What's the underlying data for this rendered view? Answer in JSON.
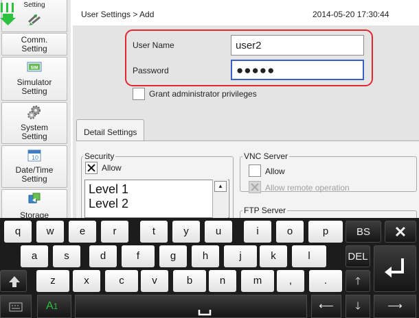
{
  "sidebar": {
    "items": [
      {
        "label": "Setting",
        "icon": "network-arrows-icon"
      },
      {
        "label": "Comm.\nSetting",
        "icon": "comm-icon"
      },
      {
        "label": "Simulator\nSetting",
        "icon": "sim-card-icon",
        "badge": "SIM"
      },
      {
        "label": "System\nSetting",
        "icon": "gears-icon"
      },
      {
        "label": "Date/Time\nSetting",
        "icon": "calendar-icon",
        "badge": "10"
      },
      {
        "label": "Storage",
        "icon": "storage-icon"
      }
    ]
  },
  "header": {
    "breadcrumb": "User Settings > Add",
    "datetime": "2014-05-20 17:30:44"
  },
  "form": {
    "user_name_label": "User Name",
    "user_name_value": "user2",
    "password_label": "Password",
    "password_value": "●●●●●",
    "grant_admin_label": "Grant administrator privileges",
    "grant_admin_checked": false
  },
  "detail": {
    "tab_label": "Detail Settings",
    "security": {
      "title": "Security",
      "allow_label": "Allow",
      "allow_checked": true,
      "levels": [
        "Level 1",
        "Level 2"
      ]
    },
    "vnc": {
      "title": "VNC Server",
      "allow_label": "Allow",
      "remote_label": "Allow remote operation"
    },
    "ftp": {
      "title": "FTP Server"
    }
  },
  "keyboard": {
    "row1": [
      "q",
      "w",
      "e",
      "r",
      "t",
      "y",
      "u",
      "i",
      "o",
      "p"
    ],
    "row2": [
      "a",
      "s",
      "d",
      "f",
      "g",
      "h",
      "j",
      "k",
      "l"
    ],
    "row3": [
      "z",
      "x",
      "c",
      "v",
      "b",
      "n",
      "m",
      ",",
      "."
    ],
    "bs_label": "BS",
    "del_label": "DEL",
    "lang_label": "A",
    "lang_sub": "1",
    "accent_color": "#2cc13f",
    "highlight_color": "#e0262f"
  }
}
